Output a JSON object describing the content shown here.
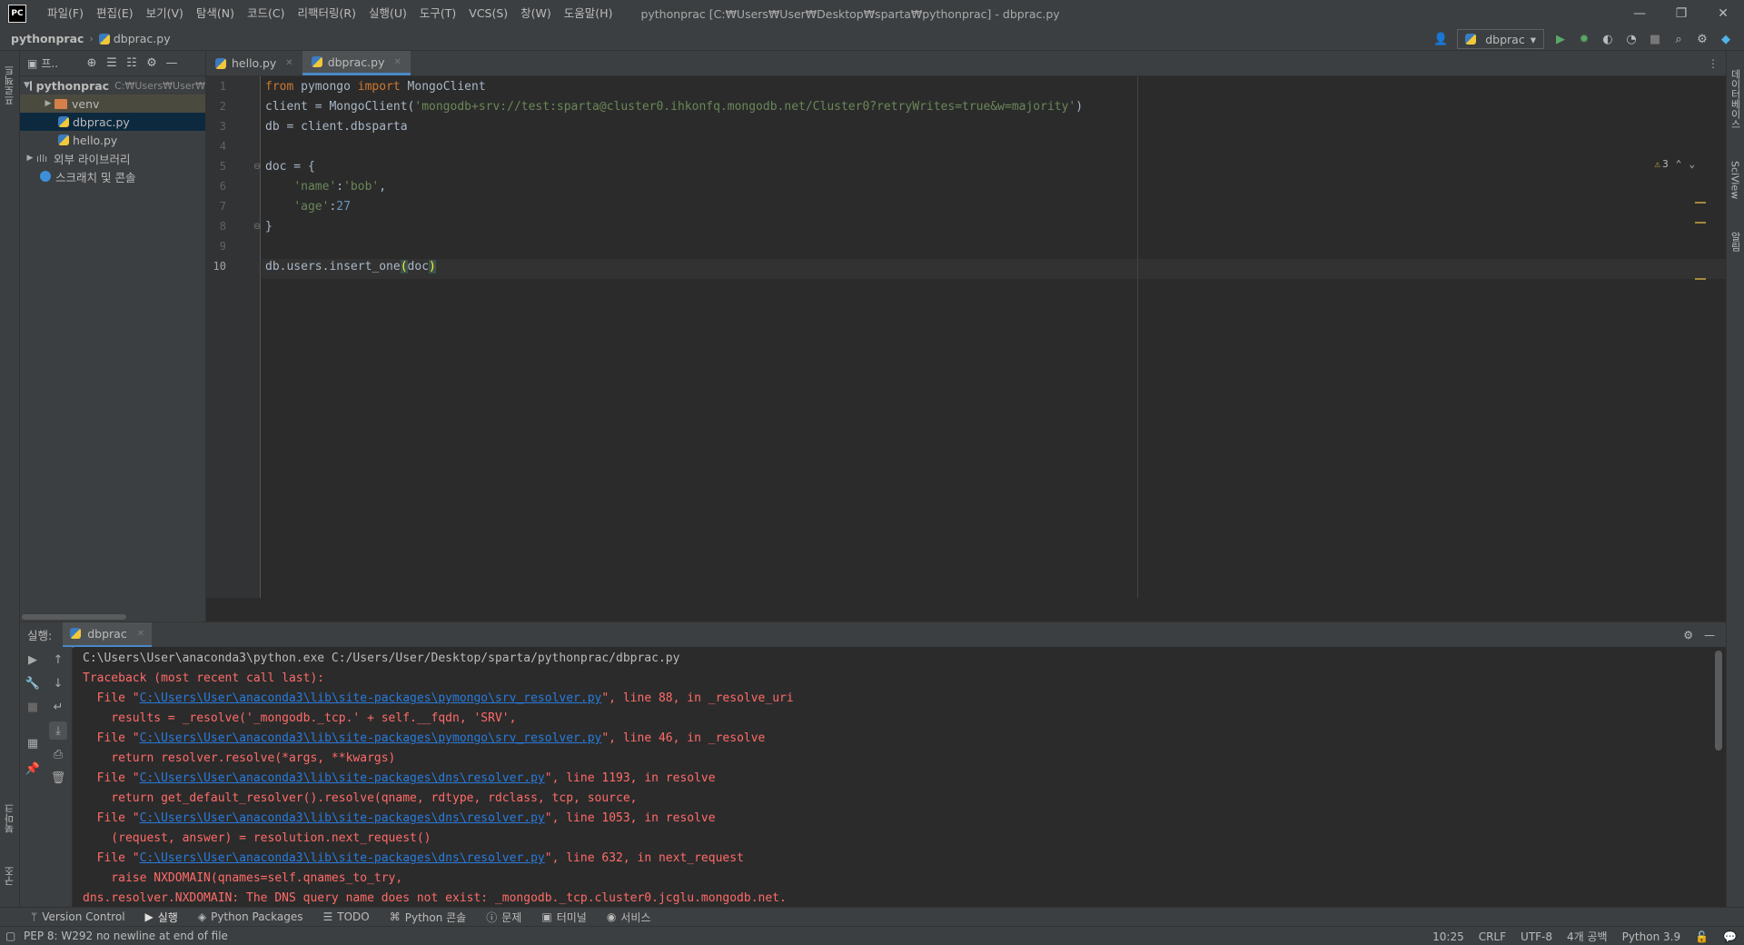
{
  "menubar": {
    "logo": "PC",
    "items": [
      "파일(F)",
      "편집(E)",
      "보기(V)",
      "탐색(N)",
      "코드(C)",
      "리팩터링(R)",
      "실행(U)",
      "도구(T)",
      "VCS(S)",
      "창(W)",
      "도움말(H)"
    ],
    "window_title": "pythonprac [C:₩Users₩User₩Desktop₩sparta₩pythonprac] - dbprac.py",
    "minimize": "—",
    "restore": "❐",
    "close": "✕"
  },
  "navbar": {
    "project": "pythonprac",
    "file": "dbprac.py",
    "run_config": "dbprac"
  },
  "left_strip": {
    "project_tab": "프로젝트",
    "bookmarks_tab": "북마크",
    "structure_tab": "구조"
  },
  "right_strip": {
    "database_tab": "데이터베이스",
    "sciview_tab": "SciView",
    "notifications_tab": "알림"
  },
  "project_panel": {
    "title": "프..",
    "root": {
      "name": "pythonprac",
      "path": "C:₩Users₩User₩"
    },
    "items": [
      {
        "name": "venv"
      },
      {
        "name": "dbprac.py"
      },
      {
        "name": "hello.py"
      }
    ],
    "external_libs": "외부 라이브러리",
    "scratches": "스크래치 및 콘솔"
  },
  "editor": {
    "tabs": [
      {
        "label": "hello.py"
      },
      {
        "label": "dbprac.py"
      }
    ],
    "line_numbers": [
      "1",
      "2",
      "3",
      "4",
      "5",
      "6",
      "7",
      "8",
      "9",
      "10"
    ],
    "warnings_count": "3",
    "code": {
      "l1_from": "from",
      "l1_mid": " pymongo ",
      "l1_import": "import",
      "l1_end": " MongoClient",
      "l2_start": "client = MongoClient(",
      "l2_str": "'mongodb+srv://test:sparta@cluster0.ihkonfq.mongodb.net/Cluster0?retryWrites=true&w=majority'",
      "l2_end": ")",
      "l3": "db = client.dbsparta",
      "l5": "doc = {",
      "l6_str1": "'name'",
      "l6_colon": ":",
      "l6_str2": "'bob'",
      "l6_comma": ",",
      "l7_str": "'age'",
      "l7_colon": ":",
      "l7_num": "27",
      "l8": "}",
      "l10_start": "db.users.insert_one",
      "l10_open": "(",
      "l10_arg": "doc",
      "l10_close": ")"
    }
  },
  "run_panel": {
    "label": "실행:",
    "tab": "dbprac",
    "console": {
      "cmd": "C:\\Users\\User\\anaconda3\\python.exe C:/Users/User/Desktop/sparta/pythonprac/dbprac.py",
      "traceback": "Traceback (most recent call last):",
      "f1_pre": "  File \"",
      "f1_link": "C:\\Users\\User\\anaconda3\\lib\\site-packages\\pymongo\\srv_resolver.py",
      "f1_post": "\", line 88, in _resolve_uri",
      "f1_code": "    results = _resolve('_mongodb._tcp.' + self.__fqdn, 'SRV',",
      "f2_pre": "  File \"",
      "f2_link": "C:\\Users\\User\\anaconda3\\lib\\site-packages\\pymongo\\srv_resolver.py",
      "f2_post": "\", line 46, in _resolve",
      "f2_code": "    return resolver.resolve(*args, **kwargs)",
      "f3_pre": "  File \"",
      "f3_link": "C:\\Users\\User\\anaconda3\\lib\\site-packages\\dns\\resolver.py",
      "f3_post": "\", line 1193, in resolve",
      "f3_code": "    return get_default_resolver().resolve(qname, rdtype, rdclass, tcp, source,",
      "f4_pre": "  File \"",
      "f4_link": "C:\\Users\\User\\anaconda3\\lib\\site-packages\\dns\\resolver.py",
      "f4_post": "\", line 1053, in resolve",
      "f4_code": "    (request, answer) = resolution.next_request()",
      "f5_pre": "  File \"",
      "f5_link": "C:\\Users\\User\\anaconda3\\lib\\site-packages\\dns\\resolver.py",
      "f5_post": "\", line 632, in next_request",
      "f5_code": "    raise NXDOMAIN(qnames=self.qnames_to_try,",
      "error": "dns.resolver.NXDOMAIN: The DNS query name does not exist: _mongodb._tcp.cluster0.jcglu.mongodb.net."
    }
  },
  "tool_windows": [
    "Version Control",
    "실행",
    "Python Packages",
    "TODO",
    "Python 콘솔",
    "문제",
    "터미널",
    "서비스"
  ],
  "status_bar": {
    "message": "PEP 8: W292 no newline at end of file",
    "position": "10:25",
    "line_sep": "CRLF",
    "encoding": "UTF-8",
    "indent": "4개 공백",
    "interpreter": "Python 3.9"
  }
}
